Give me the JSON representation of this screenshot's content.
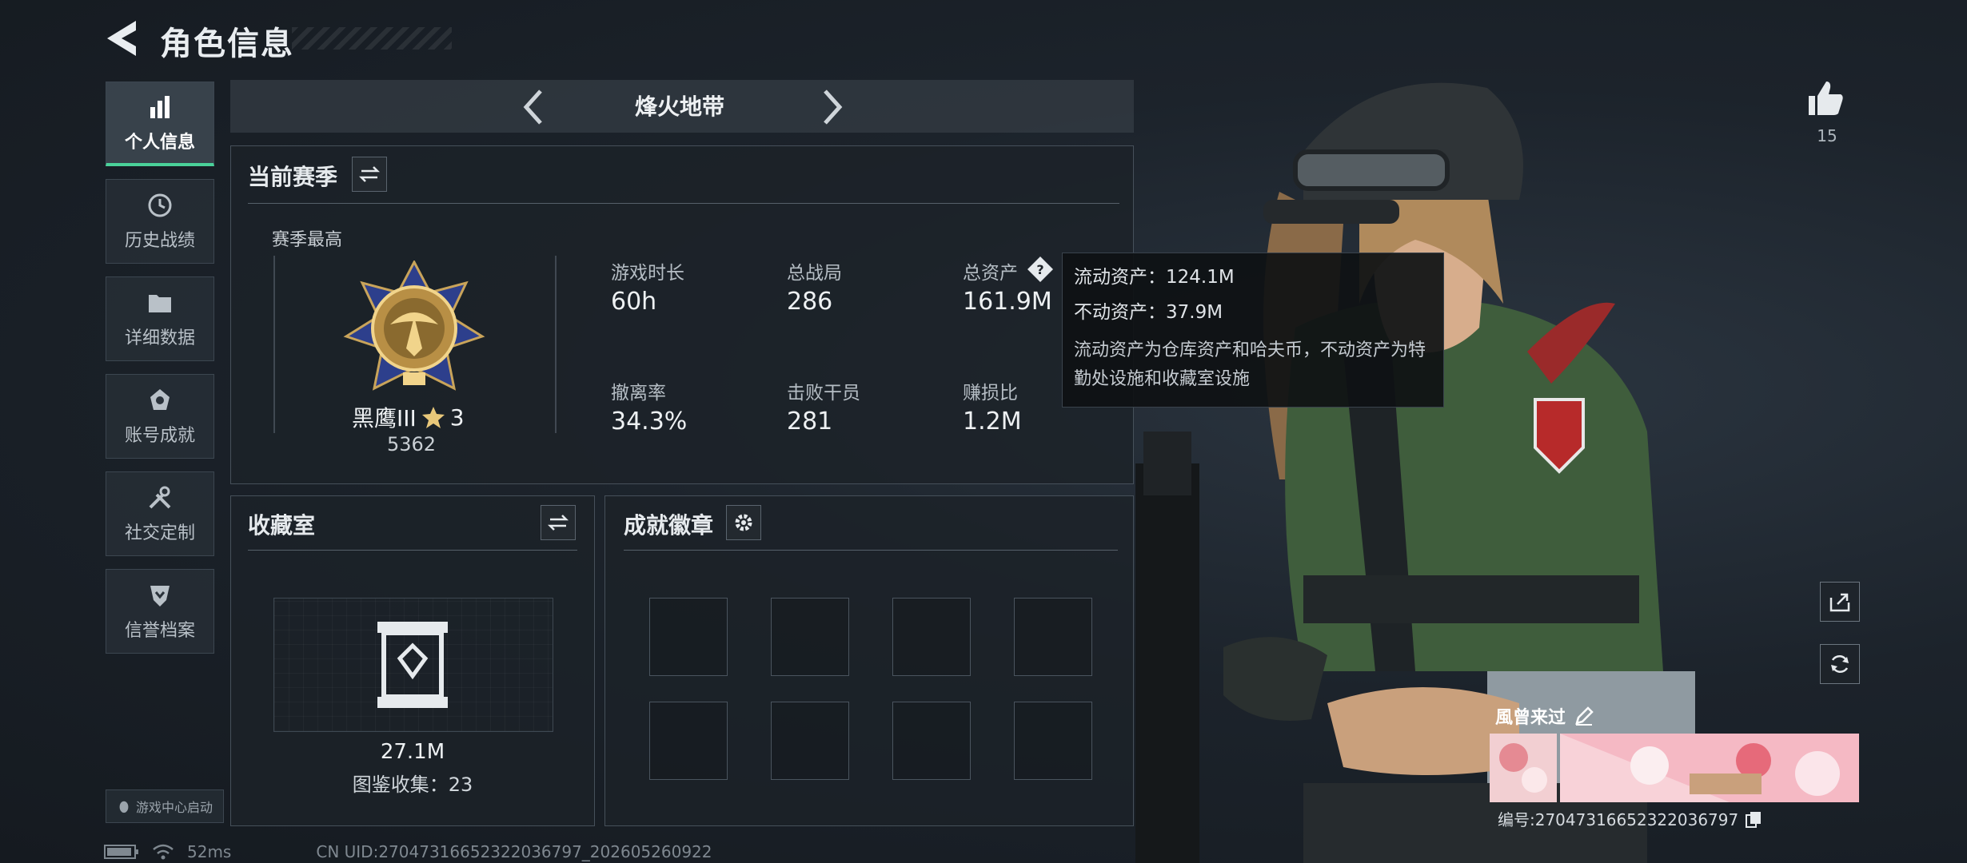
{
  "header": {
    "title": "角色信息"
  },
  "nav": [
    {
      "label": "个人信息",
      "icon": "bar-chart-icon",
      "active": true
    },
    {
      "label": "历史战绩",
      "icon": "history-icon"
    },
    {
      "label": "详细数据",
      "icon": "folder-icon"
    },
    {
      "label": "账号成就",
      "icon": "medal-icon"
    },
    {
      "label": "社交定制",
      "icon": "tools-icon"
    },
    {
      "label": "信誉档案",
      "icon": "shield-icon"
    }
  ],
  "game_center": {
    "label": "游戏中心启动"
  },
  "mode": {
    "title": "烽火地带"
  },
  "season": {
    "title": "当前赛季",
    "best_label": "赛季最高",
    "rank_name": "黑鹰III",
    "rank_stars": "3",
    "rank_points": "5362",
    "stats": [
      {
        "label": "游戏时长",
        "value": "60h"
      },
      {
        "label": "总战局",
        "value": "286"
      },
      {
        "label": "总资产",
        "value": "161.9M"
      },
      {
        "label": "撤离率",
        "value": "34.3%"
      },
      {
        "label": "击败干员",
        "value": "281"
      },
      {
        "label": "赚损比",
        "value": "1.2M"
      }
    ]
  },
  "tooltip": {
    "liquid": "流动资产：124.1M",
    "fixed": "不动资产：37.9M",
    "desc": "流动资产为仓库资产和哈夫币，不动资产为特勤处设施和收藏室设施"
  },
  "collection": {
    "title": "收藏室",
    "value": "27.1M",
    "catalog": "图鉴收集：23"
  },
  "badges": {
    "title": "成就徽章"
  },
  "likes": {
    "count": "15"
  },
  "player": {
    "name": "風曾来过",
    "uid_label": "编号:270473166523220367​97"
  },
  "status_bar": {
    "ping": "52ms",
    "uid": "CN UID:270473166523220367​97_202605260922"
  },
  "colors": {
    "accent": "#4ad19a",
    "panel": "#1c2228"
  }
}
